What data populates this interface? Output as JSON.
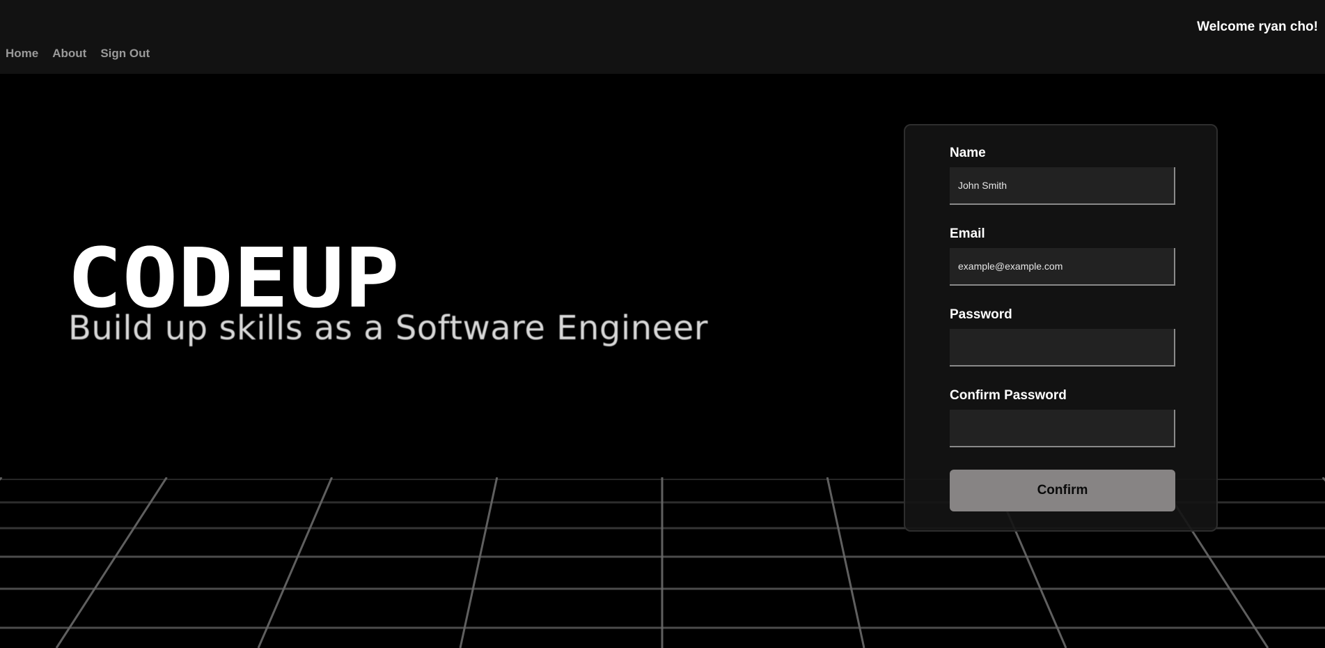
{
  "nav": {
    "welcome": "Welcome ryan cho!",
    "links": [
      "Home",
      "About",
      "Sign Out"
    ]
  },
  "hero": {
    "logo_text": "CODEUP",
    "tagline": "Build up skills as a Software Engineer"
  },
  "form": {
    "name_label": "Name",
    "name_placeholder": "John Smith",
    "email_label": "Email",
    "email_placeholder": "example@example.com",
    "password_label": "Password",
    "confirm_password_label": "Confirm Password",
    "confirm_button": "Confirm"
  },
  "colors": {
    "background": "#000000",
    "navbar": "#121212",
    "button": "#878484"
  }
}
